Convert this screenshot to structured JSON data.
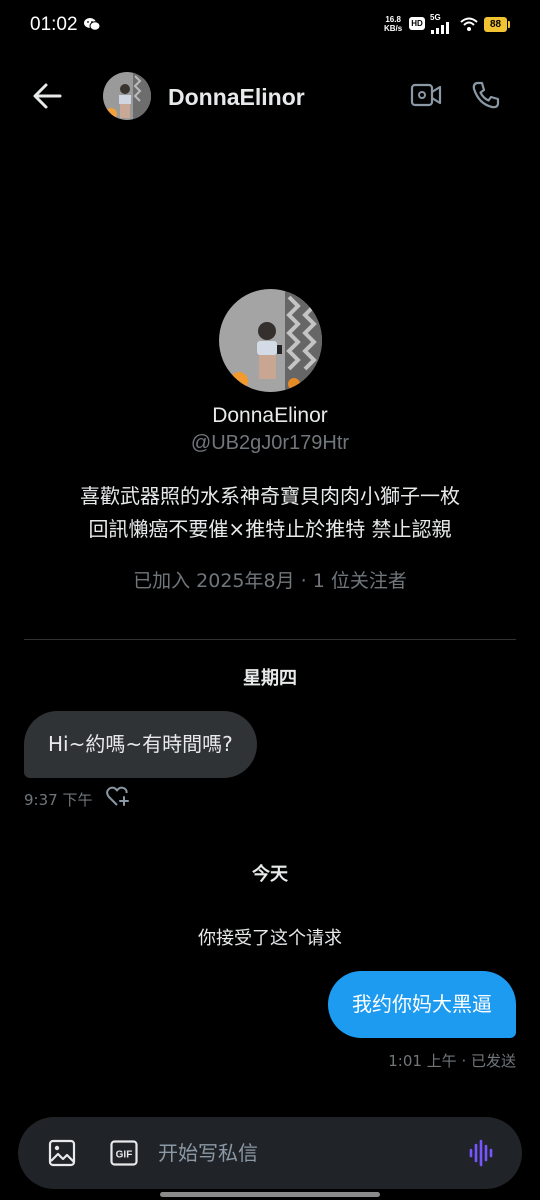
{
  "status_bar": {
    "time": "01:02",
    "net_speed_value": "16.8",
    "net_speed_unit": "KB/s",
    "hd": "HD",
    "network": "5G",
    "battery": "88"
  },
  "header": {
    "name": "DonnaElinor",
    "back_icon": "arrow-left-icon",
    "video_icon": "video-camera-icon",
    "phone_icon": "phone-icon"
  },
  "profile": {
    "name": "DonnaElinor",
    "handle": "@UB2gJ0r179Htr",
    "bio_line1": "喜歡武器照的水系神奇寶貝肉肉小獅子一枚",
    "bio_line2": "回訊懶癌不要催×推特止於推特 禁止認親",
    "meta": "已加入 2025年8月 · 1 位关注者"
  },
  "conversation": {
    "day1": "星期四",
    "incoming": {
      "text": "Hi~約嗎~有時間嗎?",
      "time": "9:37 下午"
    },
    "day2": "今天",
    "system": "你接受了这个请求",
    "outgoing": {
      "text": "我约你妈大黑逼",
      "status": "1:01 上午 · 已发送"
    }
  },
  "composer": {
    "placeholder": "开始写私信",
    "gif_label": "GIF"
  },
  "colors": {
    "background": "#000000",
    "accent": "#1d9bf0",
    "incoming_bubble": "#2f3336",
    "secondary_text": "#71767b",
    "voice_icon": "#7856ff"
  }
}
